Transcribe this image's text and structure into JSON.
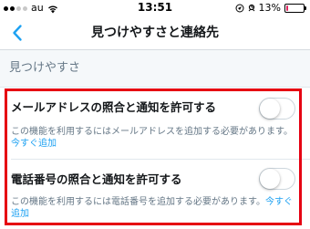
{
  "status_bar": {
    "carrier": "au",
    "time": "13:51",
    "battery_percent": "13%",
    "battery_level": 0.13,
    "signal_bars_on": 2,
    "signal_bars_total": 5
  },
  "nav": {
    "title": "見つけやすさと連絡先"
  },
  "section": {
    "title": "見つけやすさ"
  },
  "settings": [
    {
      "label": "メールアドレスの照合と通知を許可する",
      "description": "この機能を利用するにはメールアドレスを追加する必要があります。",
      "link": "今すぐ追加",
      "enabled": false
    },
    {
      "label": "電話番号の照合と通知を許可する",
      "description": "この機能を利用するには電話番号を追加する必要があります。",
      "link": "今すぐ追加",
      "enabled": false
    }
  ],
  "colors": {
    "accent": "#1da1f2",
    "highlight": "#e60012",
    "battery_low": "#e0245e"
  }
}
